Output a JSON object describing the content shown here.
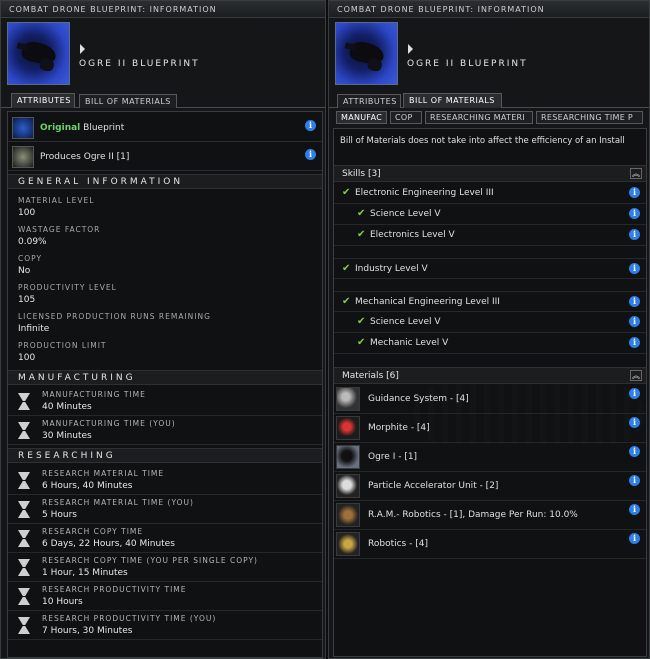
{
  "left": {
    "title": "COMBAT DRONE BLUEPRINT: INFORMATION",
    "name": "OGRE II BLUEPRINT",
    "tabs": [
      "ATTRIBUTES",
      "BILL OF MATERIALS"
    ],
    "info_rows": [
      {
        "highlight": "Original",
        "text": "Blueprint"
      },
      {
        "highlight": "",
        "text": "Produces Ogre II [1]"
      }
    ],
    "general_header": "GENERAL INFORMATION",
    "attributes": [
      {
        "label": "MATERIAL LEVEL",
        "value": "100"
      },
      {
        "label": "WASTAGE FACTOR",
        "value": "0.09%"
      },
      {
        "label": "COPY",
        "value": "No"
      },
      {
        "label": "PRODUCTIVITY LEVEL",
        "value": "105"
      },
      {
        "label": "LICENSED PRODUCTION RUNS REMAINING",
        "value": "Infinite"
      },
      {
        "label": "PRODUCTION LIMIT",
        "value": "100"
      }
    ],
    "manufacturing_header": "MANUFACTURING",
    "manufacturing": [
      {
        "label": "MANUFACTURING TIME",
        "value": "40 Minutes"
      },
      {
        "label": "MANUFACTURING TIME (YOU)",
        "value": "30 Minutes"
      }
    ],
    "researching_header": "RESEARCHING",
    "researching": [
      {
        "label": "RESEARCH MATERIAL TIME",
        "value": "6 Hours, 40 Minutes"
      },
      {
        "label": "RESEARCH MATERIAL TIME (YOU)",
        "value": "5 Hours"
      },
      {
        "label": "RESEARCH COPY TIME",
        "value": "6 Days, 22 Hours, 40 Minutes"
      },
      {
        "label": "RESEARCH COPY TIME (YOU PER SINGLE COPY)",
        "value": "1 Hour, 15 Minutes"
      },
      {
        "label": "RESEARCH PRODUCTIVITY TIME",
        "value": "10 Hours"
      },
      {
        "label": "RESEARCH PRODUCTIVITY TIME (YOU)",
        "value": "7 Hours, 30 Minutes"
      }
    ]
  },
  "right": {
    "title": "COMBAT DRONE BLUEPRINT: INFORMATION",
    "name": "OGRE II BLUEPRINT",
    "tabs": [
      "ATTRIBUTES",
      "BILL OF MATERIALS"
    ],
    "subtabs": [
      "MANUFAC",
      "COP",
      "RESEARCHING MATERI",
      "RESEARCHING TIME P"
    ],
    "notice": "Bill of Materials does not take into affect the efficiency of an Install",
    "skills_header": "Skills [3]",
    "skills": [
      {
        "text": "Electronic Engineering Level III",
        "indent": 0
      },
      {
        "text": "Science Level V",
        "indent": 1
      },
      {
        "text": "Electronics Level V",
        "indent": 1
      },
      {
        "text": "Industry Level V",
        "indent": 0
      },
      {
        "text": "Mechanical Engineering Level III",
        "indent": 0
      },
      {
        "text": "Science Level V",
        "indent": 1
      },
      {
        "text": "Mechanic Level V",
        "indent": 1
      }
    ],
    "materials_header": "Materials [6]",
    "materials": [
      {
        "text": "Guidance System - [4]",
        "icon": "guidance-system-icon"
      },
      {
        "text": "Morphite - [4]",
        "icon": "morphite-icon"
      },
      {
        "text": "Ogre I - [1]",
        "icon": "ogre-drone-icon"
      },
      {
        "text": "Particle Accelerator Unit - [2]",
        "icon": "particle-accelerator-icon"
      },
      {
        "text": "R.A.M.- Robotics - [1], Damage Per Run: 10.0%",
        "icon": "ram-robotics-icon"
      },
      {
        "text": "Robotics - [4]",
        "icon": "robotics-icon"
      }
    ]
  },
  "colors": {
    "accent": "#2f7fe8",
    "original_green": "#6bd36b",
    "check_green": "#7fd04a"
  }
}
